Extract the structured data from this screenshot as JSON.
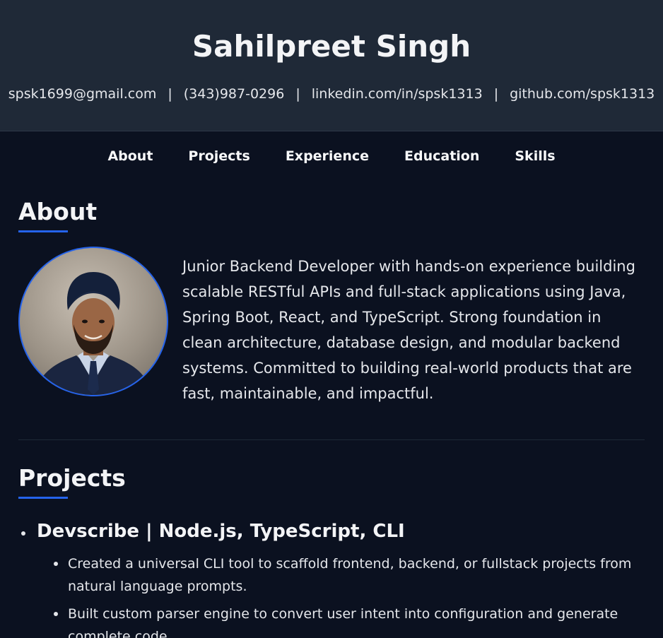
{
  "header": {
    "name": "Sahilpreet Singh",
    "email": "spsk1699@gmail.com",
    "phone": "(343)987-0296",
    "linkedin": "linkedin.com/in/spsk1313",
    "github": "github.com/spsk1313",
    "separator": "|"
  },
  "nav": {
    "items": [
      "About",
      "Projects",
      "Experience",
      "Education",
      "Skills"
    ]
  },
  "about": {
    "title": "About",
    "text": "Junior Backend Developer with hands-on experience building scalable RESTful APIs and full-stack applications using Java, Spring Boot, React, and TypeScript. Strong foundation in clean architecture, database design, and modular backend systems. Committed to building real-world products that are fast, maintainable, and impactful."
  },
  "projects": {
    "title": "Projects",
    "items": [
      {
        "title": "Devscribe | Node.js, TypeScript, CLI",
        "bullets": [
          "Created a universal CLI tool to scaffold frontend, backend, or fullstack projects from natural language prompts.",
          "Built custom parser engine to convert user intent into configuration and generate complete code."
        ]
      }
    ]
  },
  "colors": {
    "accent": "#2563eb",
    "header_bg": "#1f2937",
    "page_bg": "#0b1120"
  }
}
